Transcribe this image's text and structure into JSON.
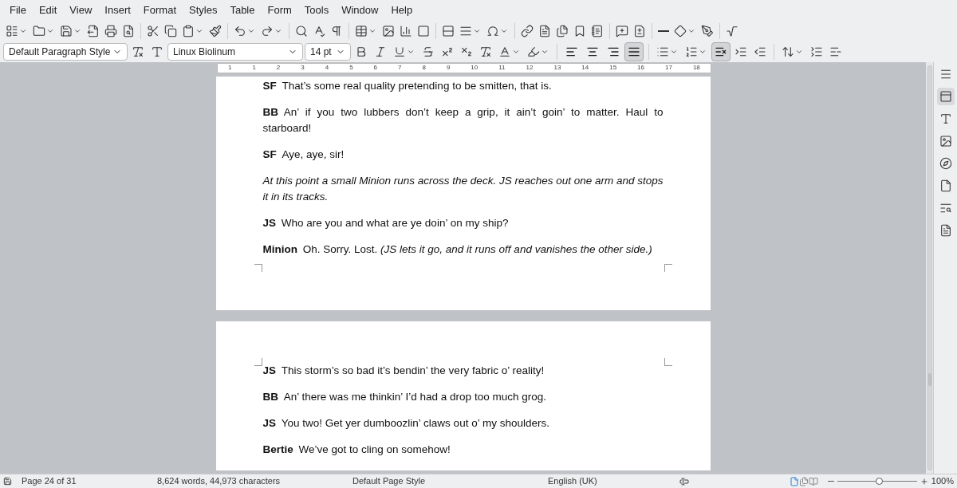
{
  "menu": [
    "File",
    "Edit",
    "View",
    "Insert",
    "Format",
    "Styles",
    "Table",
    "Form",
    "Tools",
    "Window",
    "Help"
  ],
  "formatting": {
    "paragraph_style": "Default Paragraph Style",
    "font": "Linux Biolinum",
    "size": "14 pt"
  },
  "align_buttons": [
    {
      "kind": "left",
      "selected": false
    },
    {
      "kind": "center",
      "selected": false
    },
    {
      "kind": "right",
      "selected": false
    },
    {
      "kind": "justify",
      "selected": true
    }
  ],
  "no_list_selected": true,
  "ruler": {
    "labels": [
      "1",
      "1",
      "2",
      "3",
      "4",
      "5",
      "6",
      "7",
      "8",
      "9",
      "10",
      "11",
      "12",
      "13",
      "14",
      "15",
      "16",
      "17",
      "18"
    ]
  },
  "pages": [
    {
      "paragraphs": [
        {
          "kind": "dialogue",
          "speaker": "SF",
          "text": "That’s some real quality pretending to be smitten, that is."
        },
        {
          "kind": "dialogue",
          "speaker": "BB",
          "text": "An’ if you two lubbers don’t keep a grip, it ain’t goin’ to matter.  Haul to starboard!"
        },
        {
          "kind": "dialogue",
          "speaker": "SF",
          "text": "Aye, aye, sir!"
        },
        {
          "kind": "direction",
          "text": "At this point a small Minion runs across the deck.  JS reaches out one arm and stops it in its tracks."
        },
        {
          "kind": "dialogue",
          "speaker": "JS",
          "text": "Who are you and what are ye doin’ on my ship?"
        },
        {
          "kind": "dialogue",
          "speaker": "Minion",
          "text": "Oh.  Sorry.  Lost.  *(JS lets it go, and it runs off and vanishes the other side.)*"
        }
      ]
    },
    {
      "paragraphs": [
        {
          "kind": "dialogue",
          "speaker": "JS",
          "text": "This storm’s so bad it’s bendin’ the very fabric o’ reality!"
        },
        {
          "kind": "dialogue",
          "speaker": "BB",
          "text": "An’ there was me thinkin’ I’d had a drop too much grog."
        },
        {
          "kind": "dialogue",
          "speaker": "JS",
          "text": "You two!  Get yer dumboozlin’ claws out o’ my shoulders."
        },
        {
          "kind": "dialogue",
          "speaker": "Bertie",
          "text": "We’ve got to cling on somehow!"
        }
      ]
    }
  ],
  "status_bar": {
    "page": "Page 24 of 31",
    "counts": "8,624 words, 44,973 characters",
    "page_style": "Default Page Style",
    "language": "English (UK)",
    "zoom": {
      "level": 0.52,
      "reading": "100%"
    }
  }
}
